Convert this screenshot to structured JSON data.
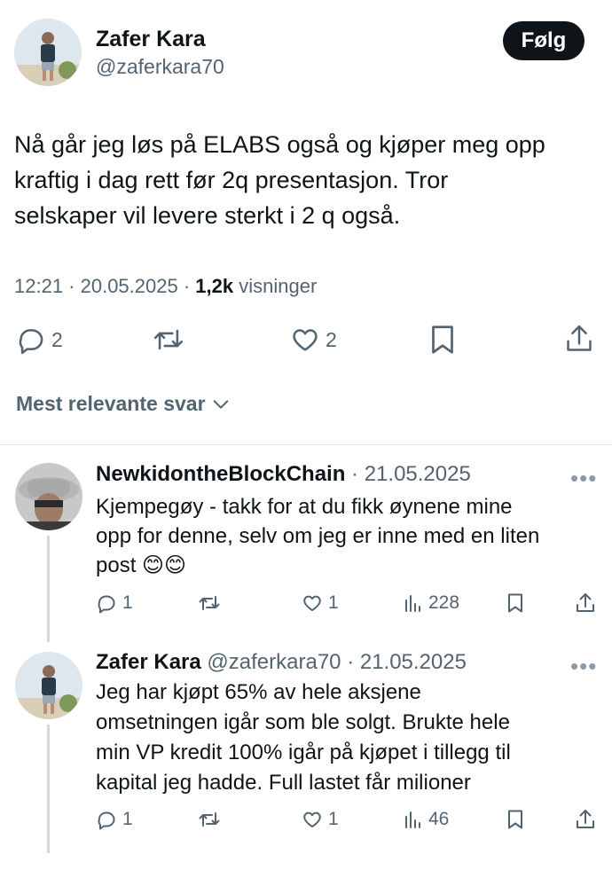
{
  "main_tweet": {
    "author_name": "Zafer Kara",
    "author_handle": "@zaferkara70",
    "follow_label": "Følg",
    "text_lines": [
      "Nå går jeg løs på ELABS også og kjøper meg opp",
      "kraftig i dag rett før 2q presentasjon. Tror",
      "selskaper vil levere sterkt i 2 q også."
    ],
    "time": "12:21 · 20.05.2025 ·",
    "views_count": "1,2k",
    "views_label": "visninger",
    "replies": "2",
    "likes": "2",
    "icons": [
      "reply-icon",
      "retweet-icon",
      "like-icon",
      "bookmark-icon",
      "share-icon"
    ]
  },
  "sort": {
    "label": "Mest relevante svar"
  },
  "replies": [
    {
      "author_name": "NewkidontheBlockChain",
      "meta": "· 21.05.2025",
      "text_lines": [
        "Kjempegøy - takk for at du fikk øynene mine",
        "opp for denne, selv om jeg er inne med en liten",
        "post 😊😊"
      ],
      "replies": "1",
      "likes": "1",
      "views": "228"
    },
    {
      "author_name": "Zafer Kara",
      "author_handle": "@zaferkara70",
      "meta": "· 21.05.2025",
      "text_lines": [
        "Jeg har kjøpt 65% av hele aksjene",
        "omsetningen igår som ble solgt. Brukte hele",
        "min VP kredit 100% igår på kjøpet i tillegg til",
        "kapital jeg hadde. Full lastet får milioner"
      ],
      "replies": "1",
      "likes": "1",
      "views": "46"
    }
  ],
  "colors": {
    "text": "#0f1419",
    "secondary": "#536471",
    "divider": "#e6e9eb",
    "thread": "#cfd9de"
  }
}
